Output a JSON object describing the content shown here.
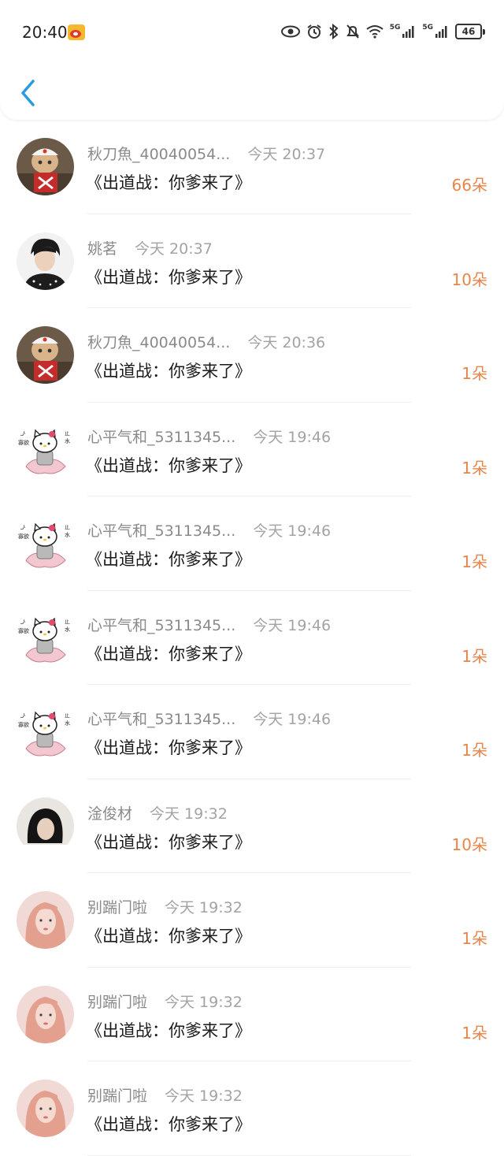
{
  "status_bar": {
    "time": "20:40",
    "network_1": "5G",
    "network_2": "5G",
    "battery": "46"
  },
  "rows": [
    {
      "name": "秋刀魚_40040054...",
      "time": "今天 20:37",
      "message": "《出道战：你爹来了》",
      "amount": "66朵",
      "avatar": "cat"
    },
    {
      "name": "姚茗",
      "time": "今天 20:37",
      "message": "《出道战：你爹来了》",
      "amount": "10朵",
      "avatar": "boy"
    },
    {
      "name": "秋刀魚_40040054...",
      "time": "今天 20:36",
      "message": "《出道战：你爹来了》",
      "amount": "1朵",
      "avatar": "cat"
    },
    {
      "name": "心平气和_5311345...",
      "time": "今天 19:46",
      "message": "《出道战：你爹来了》",
      "amount": "1朵",
      "avatar": "kitty"
    },
    {
      "name": "心平气和_5311345...",
      "time": "今天 19:46",
      "message": "《出道战：你爹来了》",
      "amount": "1朵",
      "avatar": "kitty"
    },
    {
      "name": "心平气和_5311345...",
      "time": "今天 19:46",
      "message": "《出道战：你爹来了》",
      "amount": "1朵",
      "avatar": "kitty"
    },
    {
      "name": "心平气和_5311345...",
      "time": "今天 19:46",
      "message": "《出道战：你爹来了》",
      "amount": "1朵",
      "avatar": "kitty"
    },
    {
      "name": "淦俊材",
      "time": "今天 19:32",
      "message": "《出道战：你爹来了》",
      "amount": "10朵",
      "avatar": "girl-dark"
    },
    {
      "name": "别踹门啦",
      "time": "今天 19:32",
      "message": "《出道战：你爹来了》",
      "amount": "1朵",
      "avatar": "girl-pink"
    },
    {
      "name": "别踹门啦",
      "time": "今天 19:32",
      "message": "《出道战：你爹来了》",
      "amount": "1朵",
      "avatar": "girl-pink"
    },
    {
      "name": "别踹门啦",
      "time": "今天 19:32",
      "message": "《出道战：你爹来了》",
      "amount": "",
      "avatar": "girl-pink"
    }
  ],
  "colors": {
    "accent_back": "#2a9bdf",
    "amount": "#e8854a"
  }
}
